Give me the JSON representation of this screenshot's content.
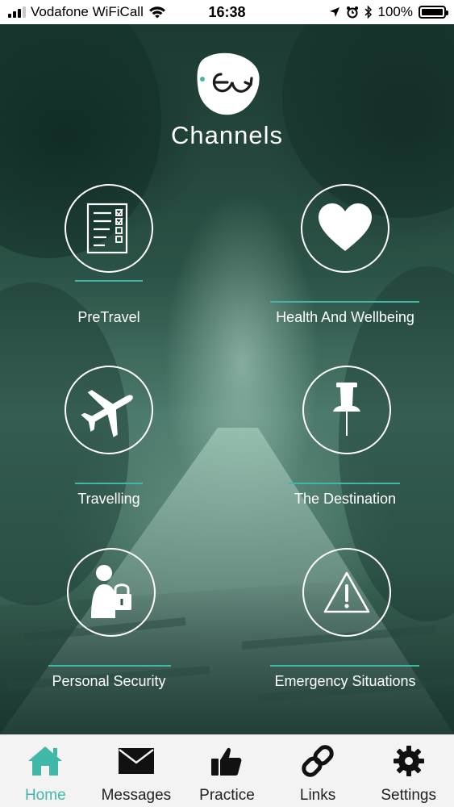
{
  "status_bar": {
    "carrier": "Vodafone WiFiCall",
    "time": "16:38",
    "battery": "100%"
  },
  "app": {
    "title": "Channels"
  },
  "channels": [
    {
      "label": "PreTravel",
      "icon": "checklist-icon"
    },
    {
      "label": "Health And Wellbeing",
      "icon": "heart-icon"
    },
    {
      "label": "Travelling",
      "icon": "airplane-icon"
    },
    {
      "label": "The Destination",
      "icon": "pushpin-icon"
    },
    {
      "label": "Personal Security",
      "icon": "person-lock-icon"
    },
    {
      "label": "Emergency Situations",
      "icon": "warning-icon"
    }
  ],
  "tabs": [
    {
      "label": "Home",
      "icon": "home-icon",
      "active": true
    },
    {
      "label": "Messages",
      "icon": "envelope-icon",
      "active": false
    },
    {
      "label": "Practice",
      "icon": "thumbs-up-icon",
      "active": false
    },
    {
      "label": "Links",
      "icon": "link-icon",
      "active": false
    },
    {
      "label": "Settings",
      "icon": "gear-icon",
      "active": false
    }
  ],
  "colors": {
    "accent": "#3fb8a8",
    "tab_bar": "#f3f3f3",
    "background": "#2b5246"
  }
}
